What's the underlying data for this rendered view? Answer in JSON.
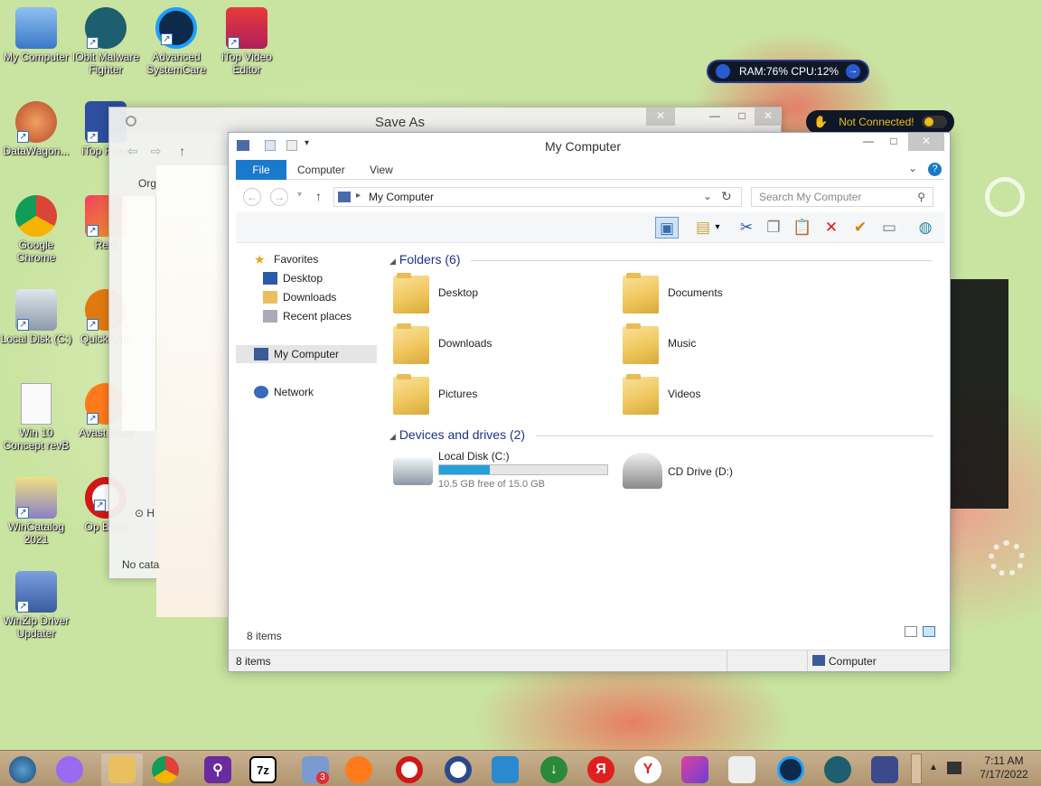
{
  "desktop_icons": [
    {
      "label": "My Computer",
      "name": "my-computer-desktop-icon",
      "color": "#4a86c8"
    },
    {
      "label": "IObit Malware Fighter",
      "name": "iobit-malware-fighter-icon",
      "color": "#2a6b7a"
    },
    {
      "label": "Advanced SystemCare",
      "name": "advanced-systemcare-icon",
      "color": "#1776c8"
    },
    {
      "label": "iTop Video Editor",
      "name": "itop-video-editor-icon",
      "color": "#e04040"
    },
    {
      "label": "DataWagon...",
      "name": "datawagon-icon",
      "color": "#c8703a"
    },
    {
      "label": "iTop Reco",
      "name": "itop-recover-icon",
      "color": "#3a5ab0"
    },
    {
      "label": "Google Chrome",
      "name": "google-chrome-icon",
      "color": "#d94a38"
    },
    {
      "label": "Rest",
      "name": "restore-icon",
      "color": "#e04070"
    },
    {
      "label": "Local Disk (C:)",
      "name": "local-disk-icon",
      "color": "#6a8aaa"
    },
    {
      "label": "Quick Upd",
      "name": "quick-update-icon",
      "color": "#e08a20"
    },
    {
      "label": "Win 10 Concept revB",
      "name": "win10-concept-file-icon",
      "color": "#e8e8e8"
    },
    {
      "label": "Avast Antiv",
      "name": "avast-antivirus-icon",
      "color": "#ff7820"
    },
    {
      "label": "WinCatalog 2021",
      "name": "wincatalog-icon",
      "color": "#8a90c8"
    },
    {
      "label": "Op Brow",
      "name": "opera-browser-icon",
      "color": "#d01818"
    },
    {
      "label": "WinZip Driver Updater",
      "name": "winzip-driver-updater-icon",
      "color": "#5a7ac0"
    }
  ],
  "widgets": {
    "ram_cpu": "RAM:76%  CPU:12%",
    "connection": "Not Connected!"
  },
  "save_as": {
    "title": "Save As",
    "org_label": "Org",
    "status_text": "No cata",
    "h_label": "H"
  },
  "explorer": {
    "title": "My Computer",
    "tabs": {
      "file": "File",
      "computer": "Computer",
      "view": "View"
    },
    "address": "My Computer",
    "search_placeholder": "Search My Computer",
    "nav": {
      "favorites": "Favorites",
      "desktop": "Desktop",
      "downloads": "Downloads",
      "recent": "Recent places",
      "my_computer": "My Computer",
      "network": "Network"
    },
    "folders_header": "Folders (6)",
    "folders": [
      {
        "label": "Desktop"
      },
      {
        "label": "Documents"
      },
      {
        "label": "Downloads"
      },
      {
        "label": "Music"
      },
      {
        "label": "Pictures"
      },
      {
        "label": "Videos"
      }
    ],
    "devices_header": "Devices and drives (2)",
    "drive_c": {
      "label": "Local Disk (C:)",
      "free": "10.5 GB free of 15.0 GB",
      "used_fraction": 0.3
    },
    "drive_d": {
      "label": "CD Drive (D:)"
    },
    "inner_status": "8 items",
    "status_left": "8 items",
    "status_right": "Computer"
  },
  "tray": {
    "time": "7:11 AM",
    "date": "7/17/2022",
    "badge_count": "3"
  },
  "colors": {
    "file_tab": "#1979ca",
    "group_header": "#1e3287",
    "progress": "#26a0da"
  }
}
